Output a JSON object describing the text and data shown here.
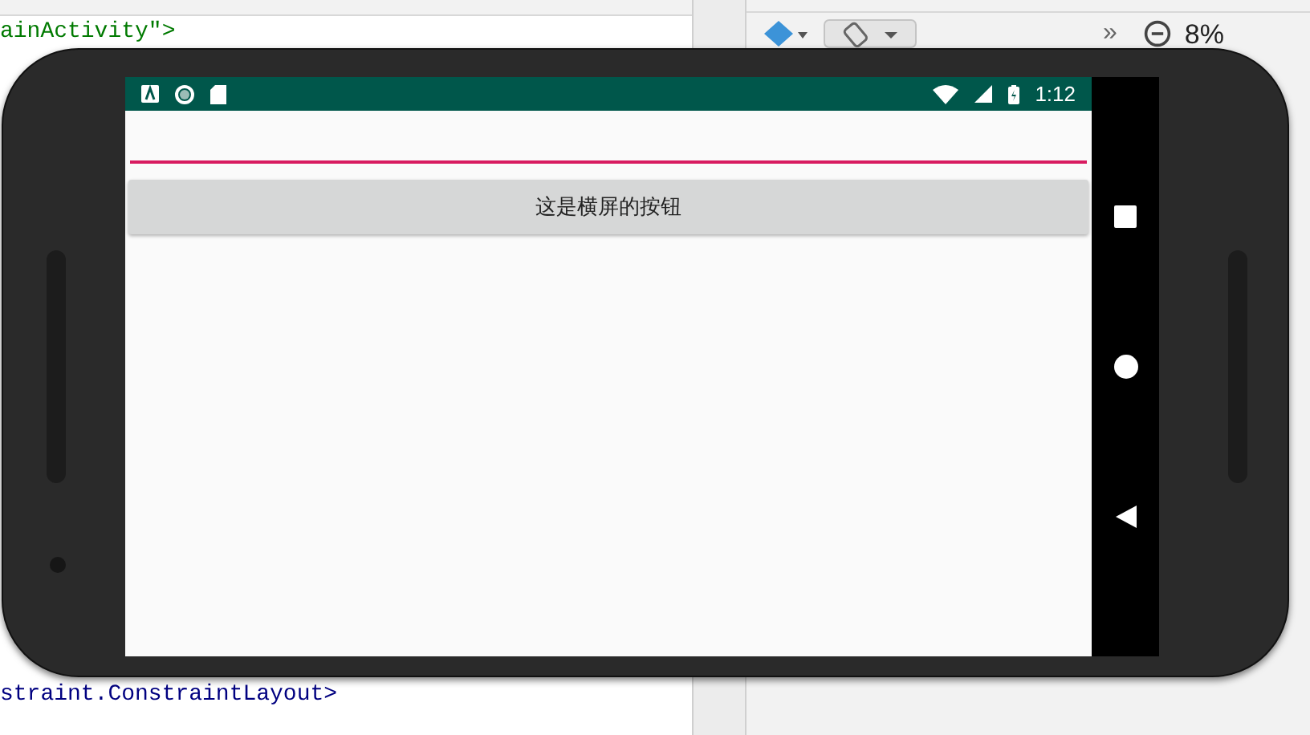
{
  "editor": {
    "top_line": "ainActivity\">",
    "bottom_line": "straint.ConstraintLayout>"
  },
  "design_toolbar": {
    "overflow": "»",
    "zoom": "8%"
  },
  "emulator": {
    "status_bar": {
      "time": "1:12"
    },
    "app": {
      "text_field": {
        "focused": true
      },
      "button": {
        "label": "这是横屏的按钮"
      }
    }
  }
}
